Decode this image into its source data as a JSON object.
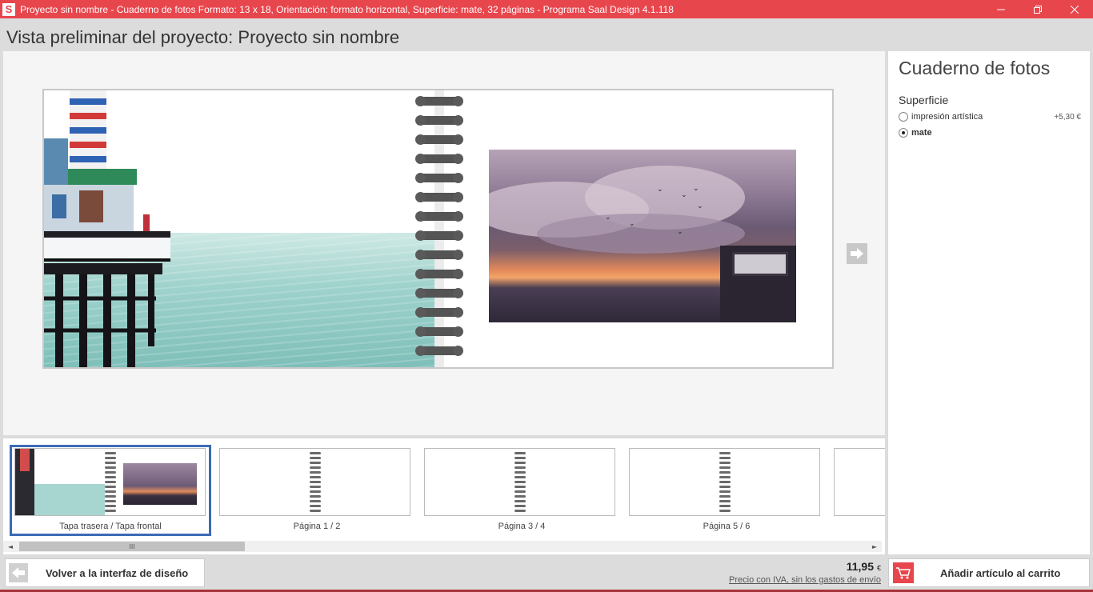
{
  "window": {
    "logo_letter": "S",
    "title": "Proyecto sin nombre - Cuaderno de fotos Formato: 13 x 18, Orientación: formato horizontal, Superficie: mate, 32 páginas - Programa Saal Design 4.1.118"
  },
  "header": {
    "title": "Vista preliminar del proyecto: Proyecto sin nombre"
  },
  "thumbnails": [
    {
      "label": "Tapa trasera / Tapa frontal",
      "active": true
    },
    {
      "label": "Página 1 / 2",
      "active": false
    },
    {
      "label": "Página 3 / 4",
      "active": false
    },
    {
      "label": "Página 5 / 6",
      "active": false
    }
  ],
  "scrollbar": {
    "grip": "III",
    "left_arrow": "◄",
    "right_arrow": "►"
  },
  "side": {
    "title": "Cuaderno de fotos",
    "section": "Superficie",
    "options": [
      {
        "label": "impresión artística",
        "price": "+5,30 €",
        "selected": false
      },
      {
        "label": "mate",
        "price": "",
        "selected": true
      }
    ]
  },
  "footer": {
    "back_label": "Volver a la interfaz de diseño",
    "price": "11,95",
    "currency": "€",
    "price_note": "Precio con IVA, sin los gastos de envío",
    "cart_label": "Añadir artículo al carrito"
  },
  "colors": {
    "accent": "#e8464d",
    "selection": "#3b6bb5"
  },
  "icons": {
    "back": "arrow-left-icon",
    "next": "arrow-right-icon",
    "cart": "cart-icon"
  }
}
